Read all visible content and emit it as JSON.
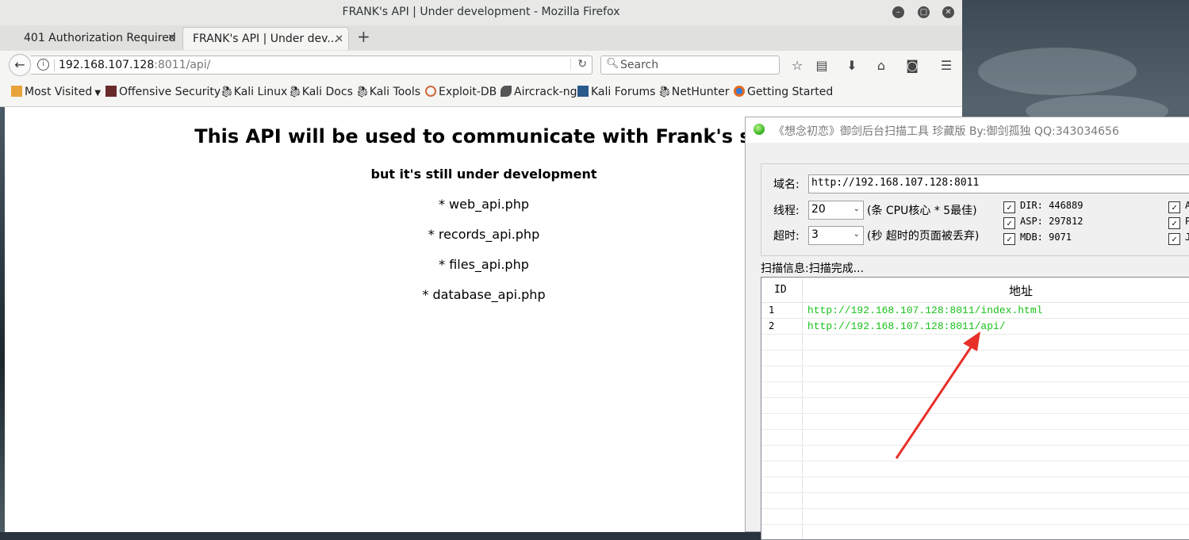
{
  "browser": {
    "window_title": "FRANK's API | Under development - Mozilla Firefox",
    "tabs": [
      {
        "label": "401 Authorization Required",
        "active": false
      },
      {
        "label": "FRANK's API | Under dev...",
        "active": true
      }
    ],
    "url_host": "192.168.107.128",
    "url_rest": ":8011/api/",
    "search_placeholder": "Search",
    "bookmarks": [
      "Most Visited",
      "Offensive Security",
      "Kali Linux",
      "Kali Docs",
      "Kali Tools",
      "Exploit-DB",
      "Aircrack-ng",
      "Kali Forums",
      "NetHunter",
      "Getting Started"
    ]
  },
  "page": {
    "heading": "This API will be used to communicate with Frank's ser",
    "subheading": "but it's still under development",
    "items": [
      "* web_api.php",
      "* records_api.php",
      "* files_api.php",
      "* database_api.php"
    ]
  },
  "scanner": {
    "title": "《想念初恋》御剑后台扫描工具 珍藏版 By:御剑孤独 QQ:343034656",
    "domain_label": "域名:",
    "domain_value": "http://192.168.107.128:8011",
    "threads_label": "线程:",
    "threads_value": "20",
    "threads_hint": "(条 CPU核心 * 5最佳)",
    "timeout_label": "超时:",
    "timeout_value": "3",
    "timeout_hint": "(秒 超时的页面被丢弃)",
    "dicts": [
      {
        "label": "DIR: 446889",
        "checked": true
      },
      {
        "label": "ASP: 297812",
        "checked": true
      },
      {
        "label": "MDB: 9071",
        "checked": true
      }
    ],
    "dicts_right": [
      {
        "label": "A",
        "checked": true
      },
      {
        "label": "P",
        "checked": true
      },
      {
        "label": "J",
        "checked": true
      }
    ],
    "status_label": "扫描信息:",
    "status_value": "扫描完成...",
    "columns": [
      "ID",
      "地址"
    ],
    "results": [
      {
        "id": "1",
        "url": "http://192.168.107.128:8011/index.html"
      },
      {
        "id": "2",
        "url": "http://192.168.107.128:8011/api/"
      }
    ],
    "result_color": "#18c018"
  },
  "annotation_color": "#e8302a"
}
